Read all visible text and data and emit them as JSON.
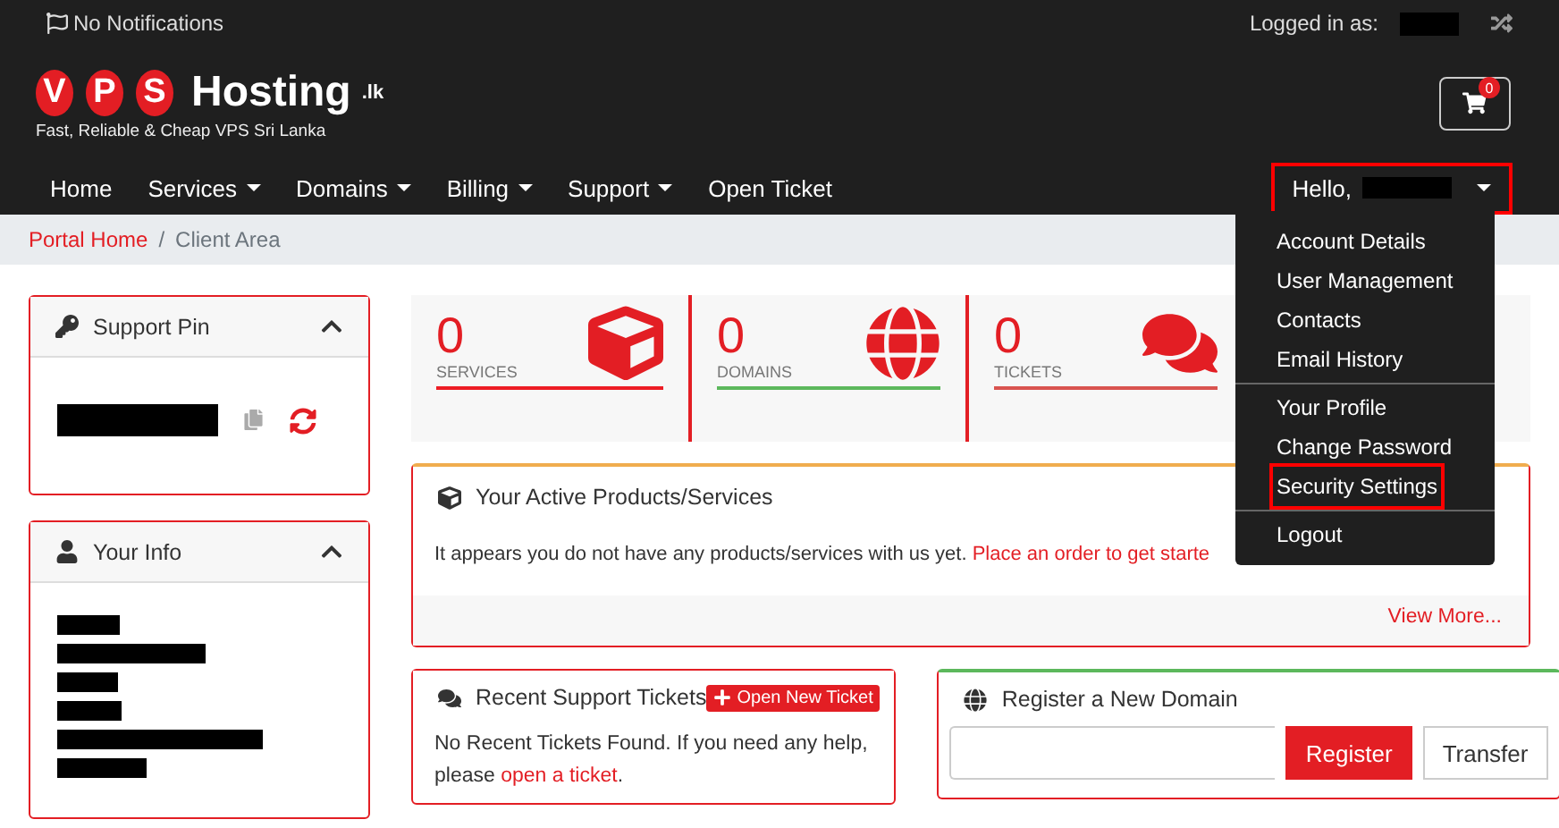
{
  "top_bar": {
    "notifications": "No Notifications",
    "logged_in_label": "Logged in as:"
  },
  "logo": {
    "letters": [
      "V",
      "P",
      "S"
    ],
    "word": "Hosting",
    "suffix": ".lk",
    "tagline": "Fast, Reliable & Cheap VPS Sri Lanka"
  },
  "cart": {
    "count": "0"
  },
  "nav": [
    {
      "label": "Home",
      "dropdown": false
    },
    {
      "label": "Services",
      "dropdown": true
    },
    {
      "label": "Domains",
      "dropdown": true
    },
    {
      "label": "Billing",
      "dropdown": true
    },
    {
      "label": "Support",
      "dropdown": true
    },
    {
      "label": "Open Ticket",
      "dropdown": false
    }
  ],
  "user_menu": {
    "greeting": "Hello,",
    "highlighted": true,
    "expanded": true,
    "groups": [
      [
        {
          "label": "Account Details",
          "highlighted": false
        },
        {
          "label": "User Management",
          "highlighted": false
        },
        {
          "label": "Contacts",
          "highlighted": false
        },
        {
          "label": "Email History",
          "highlighted": false
        }
      ],
      [
        {
          "label": "Your Profile",
          "highlighted": false
        },
        {
          "label": "Change Password",
          "highlighted": false
        },
        {
          "label": "Security Settings",
          "highlighted": true
        }
      ],
      [
        {
          "label": "Logout",
          "highlighted": false
        }
      ]
    ]
  },
  "breadcrumb_separator": "/",
  "breadcrumb": [
    {
      "label": "Portal Home",
      "kind": "link"
    },
    {
      "label": "Client Area",
      "kind": "current"
    }
  ],
  "sidebar": [
    {
      "kind": "pin",
      "title": "Support Pin",
      "expanded": true
    },
    {
      "kind": "info",
      "title": "Your Info",
      "expanded": true
    }
  ],
  "stats": [
    {
      "kind": "box",
      "count": "0",
      "label": "SERVICES",
      "color": "#ed1c24"
    },
    {
      "kind": "globe",
      "count": "0",
      "label": "DOMAINS",
      "color": "#5cb85c"
    },
    {
      "kind": "chat",
      "count": "0",
      "label": "TICKETS",
      "color": "#d9534f"
    }
  ],
  "products_panel": {
    "title": "Your Active Products/Services",
    "text": "It appears you do not have any products/services with us yet.",
    "link": "Place an order to get starte",
    "footer_link": "View More..."
  },
  "tickets_panel": {
    "title": "Recent Support Tickets",
    "button": "Open New Ticket",
    "text": "No Recent Tickets Found. If you need any help, please",
    "link": "open a ticket",
    "end": "."
  },
  "domain_panel": {
    "title": "Register a New Domain",
    "buttons": [
      "Register",
      "Transfer"
    ]
  }
}
